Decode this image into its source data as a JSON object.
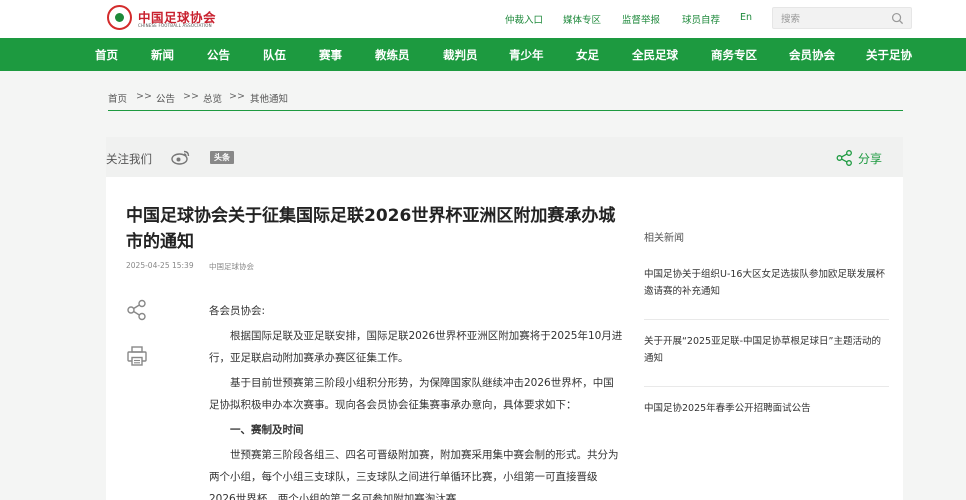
{
  "header": {
    "logo": {
      "cn": "中国足球协会",
      "en": "CHINESE FOOTBALL ASSOCIATION"
    },
    "links": [
      "仲裁入口",
      "媒体专区",
      "监督举报",
      "球员自荐",
      "En"
    ],
    "search": {
      "placeholder": "搜索"
    }
  },
  "nav": {
    "items": [
      "首页",
      "新闻",
      "公告",
      "队伍",
      "赛事",
      "教练员",
      "裁判员",
      "青少年",
      "女足",
      "全民足球",
      "商务专区",
      "会员协会",
      "关于足协"
    ]
  },
  "breadcrumb": {
    "items": [
      "首页",
      "公告",
      "总览",
      "其他通知"
    ],
    "separator": ">>"
  },
  "share_bar": {
    "follow_label": "关注我们",
    "toutiao_label": "头条",
    "share_label": "分享"
  },
  "article": {
    "title": "中国足球协会关于征集国际足联2026世界杯亚洲区附加赛承办城市的通知",
    "date": "2025-04-25 15:39",
    "source": "中国足球协会",
    "paragraphs": {
      "salutation": "各会员协会:",
      "p1": "根据国际足联及亚足联安排，国际足联2026世界杯亚洲区附加赛将于2025年10月进行，亚足联启动附加赛承办赛区征集工作。",
      "p2": "基于目前世预赛第三阶段小组积分形势，为保障国家队继续冲击2026世界杯，中国足协拟积极申办本次赛事。现向各会员协会征集赛事承办意向，具体要求如下：",
      "section1": "一、赛制及时间",
      "p3": "世预赛第三阶段各组三、四名可晋级附加赛，附加赛采用集中赛会制的形式。共分为两个小组，每个小组三支球队，三支球队之间进行单循环比赛，小组第一可直接晋级2026世界杯，两个小组的第二名可参加附加赛淘汰赛。"
    }
  },
  "sidebar": {
    "related_title": "相关新闻",
    "items": [
      "中国足协关于组织U-16大区女足选拔队参加欧足联发展杯邀请赛的补充通知",
      "关于开展“2025亚足联-中国足协草根足球日”主题活动的通知",
      "中国足协2025年春季公开招聘面试公告"
    ]
  }
}
